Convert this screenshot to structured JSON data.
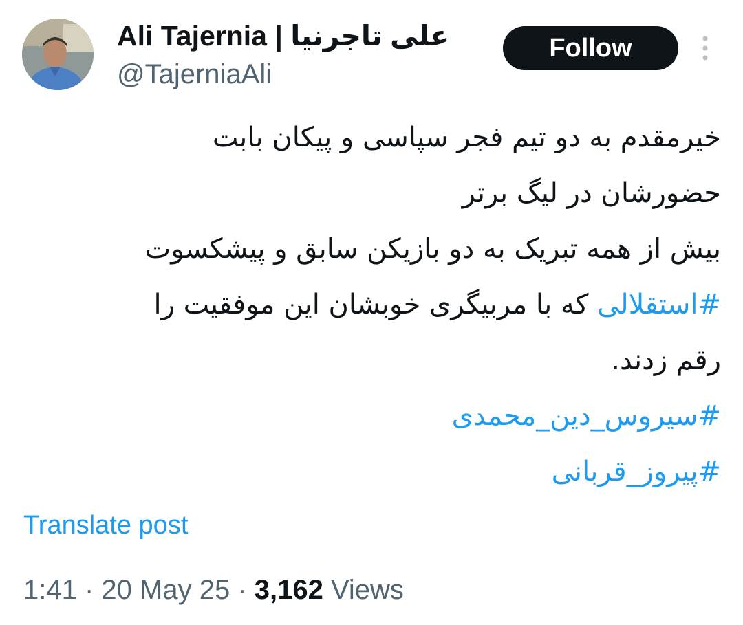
{
  "author": {
    "display_name_en": "Ali Tajernia",
    "separator": "|",
    "display_name_fa": "علی تاجرنیا",
    "handle": "@TajerniaAli",
    "avatar_icon": "person-photo-icon"
  },
  "follow_label": "Follow",
  "more_icon": "more-vertical-icon",
  "tweet": {
    "line1": "خیرمقدم به دو تیم فجر سپاسی و پیکان بابت",
    "line2": "حضورشان در لیگ برتر",
    "line3": "بیش از همه تبریک به دو بازیکن سابق و پیشکسوت",
    "hashtag_esteghlali": "#استقلالی",
    "line4_rest": " که با مربیگری خوبشان این موفقیت را",
    "line5": "رقم زدند.",
    "hashtag_cyrus": "#سیروس_دین_محمدی",
    "hashtag_pirooz": "#پیروز_قربانی"
  },
  "translate_label": "Translate post",
  "meta": {
    "time": "1:41",
    "dot": " · ",
    "date": "20 May 25",
    "views_count": "3,162",
    "views_label": " Views"
  },
  "colors": {
    "link": "#1d9bf0",
    "text": "#0f1419",
    "secondary": "#536471",
    "button_bg": "#0f1419"
  }
}
